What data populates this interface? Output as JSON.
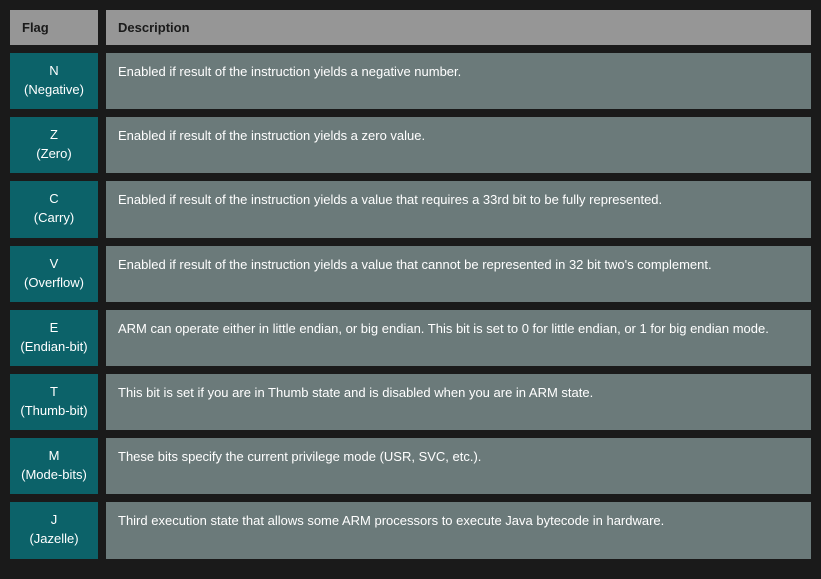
{
  "headers": {
    "flag": "Flag",
    "description": "Description"
  },
  "rows": [
    {
      "letter": "N",
      "name": "(Negative)",
      "desc": "Enabled if result of the instruction yields a negative number."
    },
    {
      "letter": "Z",
      "name": "(Zero)",
      "desc": "Enabled if result of the instruction yields a zero value."
    },
    {
      "letter": "C",
      "name": "(Carry)",
      "desc": "Enabled if result of the instruction yields a value that requires a 33rd bit to be fully represented."
    },
    {
      "letter": "V",
      "name": "(Overflow)",
      "desc": "Enabled if result of the instruction yields a value that cannot be represented in 32 bit two's complement."
    },
    {
      "letter": "E",
      "name": "(Endian-bit)",
      "desc": "ARM can operate either in little endian, or big endian. This bit is set to 0 for little endian, or 1 for big endian mode."
    },
    {
      "letter": "T",
      "name": "(Thumb-bit)",
      "desc": "This bit is set if you are in Thumb state and is disabled when you are in ARM state."
    },
    {
      "letter": "M",
      "name": "(Mode-bits)",
      "desc": "These bits specify the current privilege mode (USR, SVC, etc.)."
    },
    {
      "letter": "J",
      "name": "(Jazelle)",
      "desc": "Third execution state that allows some ARM processors to execute Java bytecode in hardware."
    }
  ]
}
